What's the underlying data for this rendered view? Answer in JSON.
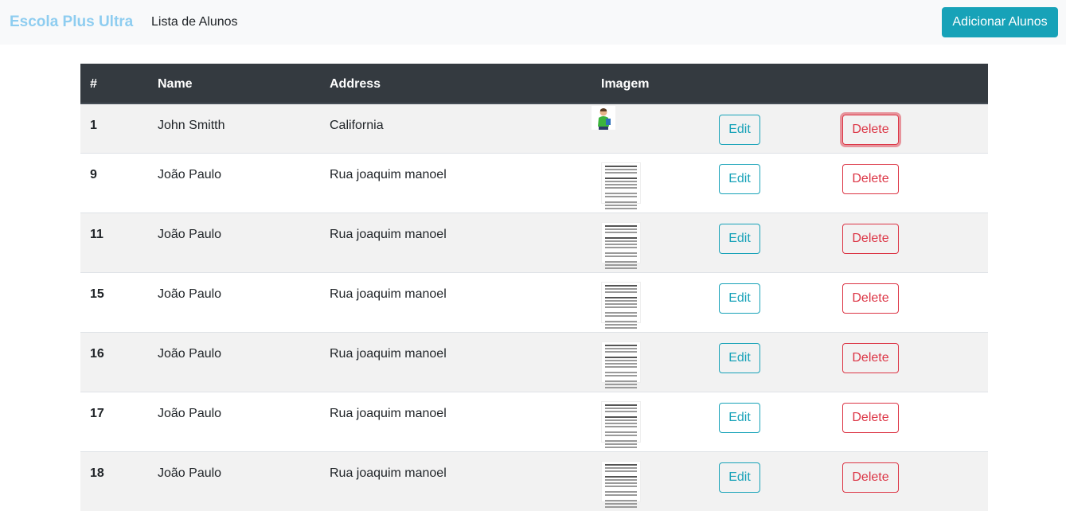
{
  "navbar": {
    "brand": "Escola Plus Ultra",
    "link": "Lista de Alunos",
    "add_button": "Adicionar Alunos"
  },
  "table": {
    "headers": [
      "#",
      "Name",
      "Address",
      "Imagem",
      "",
      ""
    ],
    "rows": [
      {
        "id": "1",
        "name": "John Smitth",
        "address": "California",
        "image": "student-photo",
        "edit": "Edit",
        "delete": "Delete"
      },
      {
        "id": "9",
        "name": "João Paulo",
        "address": "Rua joaquim manoel",
        "image": "document-thumbnail",
        "edit": "Edit",
        "delete": "Delete"
      },
      {
        "id": "11",
        "name": "João Paulo",
        "address": "Rua joaquim manoel",
        "image": "document-thumbnail",
        "edit": "Edit",
        "delete": "Delete"
      },
      {
        "id": "15",
        "name": "João Paulo",
        "address": "Rua joaquim manoel",
        "image": "document-thumbnail",
        "edit": "Edit",
        "delete": "Delete"
      },
      {
        "id": "16",
        "name": "João Paulo",
        "address": "Rua joaquim manoel",
        "image": "document-thumbnail",
        "edit": "Edit",
        "delete": "Delete"
      },
      {
        "id": "17",
        "name": "João Paulo",
        "address": "Rua joaquim manoel",
        "image": "document-thumbnail",
        "edit": "Edit",
        "delete": "Delete"
      },
      {
        "id": "18",
        "name": "João Paulo",
        "address": "Rua joaquim manoel",
        "image": "document-thumbnail",
        "edit": "Edit",
        "delete": "Delete"
      }
    ]
  },
  "colors": {
    "brand": "#8ecdf0",
    "info": "#17a2b8",
    "danger": "#dc3545",
    "table_head": "#343a40",
    "stripe": "#f2f2f2"
  }
}
